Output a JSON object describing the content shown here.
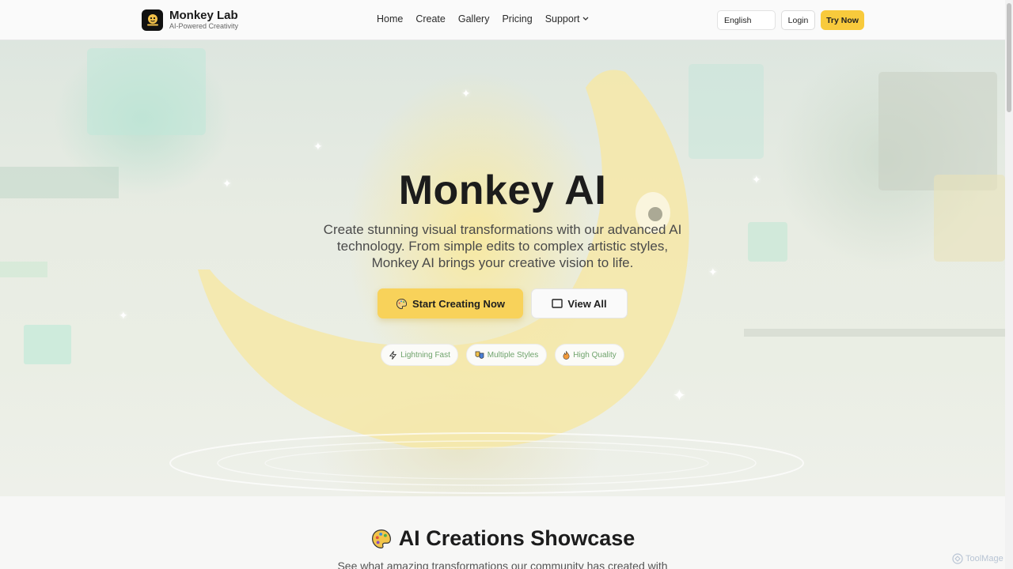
{
  "brand": {
    "name": "Monkey Lab",
    "tagline": "AI-Powered Creativity",
    "logo_icon": "monkey-logo-icon"
  },
  "nav": {
    "items": [
      {
        "label": "Home"
      },
      {
        "label": "Create"
      },
      {
        "label": "Gallery"
      },
      {
        "label": "Pricing"
      },
      {
        "label": "Support"
      }
    ],
    "language": "English",
    "login_label": "Login",
    "try_label": "Try Now"
  },
  "hero": {
    "title": "Monkey AI",
    "subtitle": "Create stunning visual transformations with our advanced AI technology. From simple edits to complex artistic styles, Monkey AI brings your creative vision to life.",
    "primary_cta": "Start Creating Now",
    "primary_cta_icon": "palette-icon",
    "secondary_cta": "View All",
    "secondary_cta_icon": "gallery-frame-icon",
    "features": [
      {
        "label": "Lightning Fast",
        "icon": "lightning-icon"
      },
      {
        "label": "Multiple Styles",
        "icon": "theater-masks-icon"
      },
      {
        "label": "High Quality",
        "icon": "flame-icon"
      }
    ]
  },
  "showcase": {
    "title": "AI Creations Showcase",
    "title_icon": "palette-icon",
    "subtitle": "See what amazing transformations our community has created with"
  },
  "watermark": "ToolMage",
  "colors": {
    "accent": "#f8ca3c",
    "feature_text": "#6fa36c"
  }
}
